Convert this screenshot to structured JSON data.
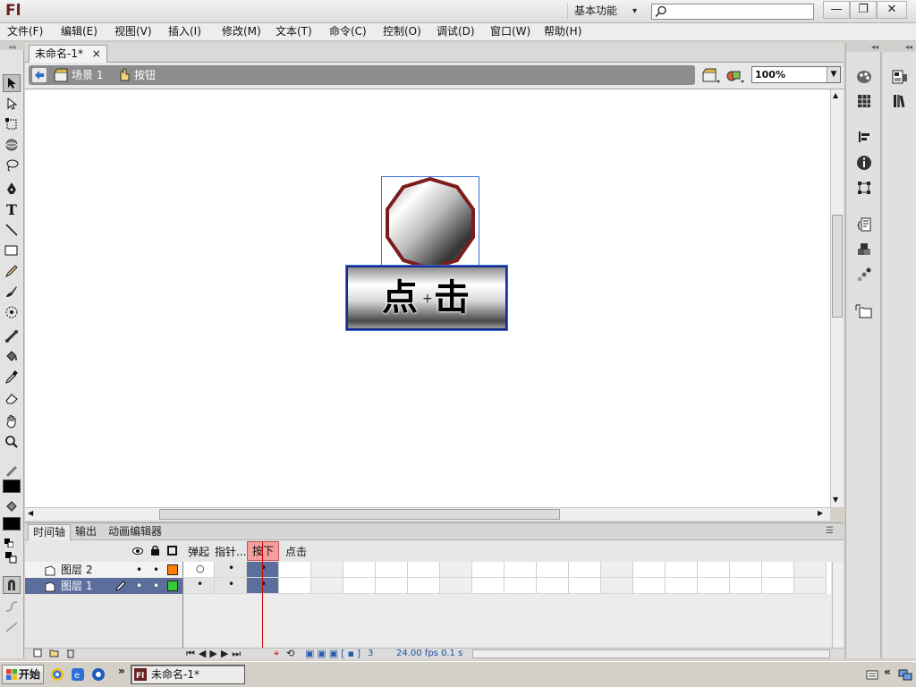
{
  "app": {
    "logo": "Fl",
    "workspace": "基本功能",
    "search": {
      "placeholder": "",
      "value": ""
    },
    "window_buttons": [
      "—",
      "❐",
      "✕"
    ]
  },
  "menu": [
    "文件(F)",
    "编辑(E)",
    "视图(V)",
    "插入(I)",
    "修改(M)",
    "文本(T)",
    "命令(C)",
    "控制(O)",
    "调试(D)",
    "窗口(W)",
    "帮助(H)"
  ],
  "document": {
    "tab_label": "未命名-1*",
    "close_glyph": "×"
  },
  "editbar": {
    "scene_label": "场景 1",
    "symbol_label": "按钮",
    "zoom": "100%"
  },
  "stage": {
    "button_text": "点 击",
    "colors": {
      "border_red": "#7c1d1d",
      "button_border": "#1b2a8a",
      "selection": "#3a6fd8"
    }
  },
  "timeline": {
    "tabs": [
      "时间轴",
      "输出",
      "动画编辑器"
    ],
    "frame_labels": [
      "弹起",
      "指针...",
      "按下",
      "点击"
    ],
    "layers": [
      {
        "name": "图层 2"
      },
      {
        "name": "图层 1"
      }
    ],
    "status": {
      "frame": "3",
      "fps": "24.00 fps",
      "time": "0.1 s"
    },
    "colors": {
      "layer2": "#ff8000",
      "layer1": "#33cc33",
      "playhead": "#cc0000",
      "current_frame_label": "#f49e9e"
    }
  },
  "taskbar": {
    "start_label": "开始",
    "task_label": "未命名-1*",
    "chevron": "»",
    "tray_chevron": "«"
  }
}
